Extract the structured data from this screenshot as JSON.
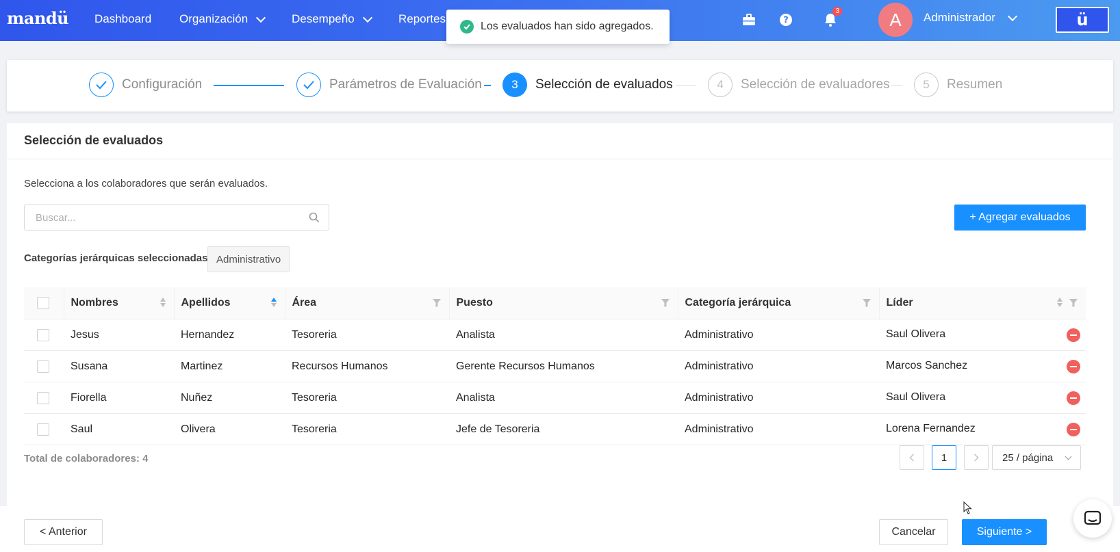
{
  "nav": {
    "logo": "mandü",
    "items": [
      {
        "label": "Dashboard"
      },
      {
        "label": "Organización"
      },
      {
        "label": "Desempeño"
      },
      {
        "label": "Reportes"
      }
    ],
    "notification_count": "3",
    "avatar_letter": "A",
    "username": "Administrador",
    "brand_glyph": "ü"
  },
  "toast": {
    "message": "Los evaluados han sido agregados."
  },
  "steps": [
    {
      "number": "",
      "label": "Configuración",
      "status": "done"
    },
    {
      "number": "",
      "label": "Parámetros de Evaluación",
      "status": "done"
    },
    {
      "number": "3",
      "label": "Selección de evaluados",
      "status": "current"
    },
    {
      "number": "4",
      "label": "Selección de evaluadores",
      "status": "wait"
    },
    {
      "number": "5",
      "label": "Resumen",
      "status": "wait"
    }
  ],
  "card": {
    "title": "Selección de evaluados",
    "subtitle": "Selecciona a los colaboradores que serán evaluados.",
    "search_placeholder": "Buscar...",
    "add_button": "+ Agregar evaluados",
    "categories_label": "Categorías jerárquicas seleccionadas:",
    "category_tag": "Administrativo"
  },
  "table": {
    "headers": {
      "nombres": "Nombres",
      "apellidos": "Apellidos",
      "area": "Área",
      "puesto": "Puesto",
      "categoria": "Categoría jerárquica",
      "lider": "Líder"
    },
    "rows": [
      {
        "nombres": "Jesus",
        "apellidos": "Hernandez",
        "area": "Tesoreria",
        "puesto": "Analista",
        "categoria": "Administrativo",
        "lider": "Saul Olivera"
      },
      {
        "nombres": "Susana",
        "apellidos": "Martinez",
        "area": "Recursos Humanos",
        "puesto": "Gerente Recursos Humanos",
        "categoria": "Administrativo",
        "lider": "Marcos Sanchez"
      },
      {
        "nombres": "Fiorella",
        "apellidos": "Nuñez",
        "area": "Tesoreria",
        "puesto": "Analista",
        "categoria": "Administrativo",
        "lider": "Saul Olivera"
      },
      {
        "nombres": "Saul",
        "apellidos": "Olivera",
        "area": "Tesoreria",
        "puesto": "Jefe de Tesoreria",
        "categoria": "Administrativo",
        "lider": "Lorena Fernandez"
      }
    ]
  },
  "pagination": {
    "total": "Total de colaboradores: 4",
    "current_page": "1",
    "page_size": "25 / página"
  },
  "footer": {
    "previous": "< Anterior",
    "cancel": "Cancelar",
    "next": "Siguiente >"
  },
  "colors": {
    "primary": "#1890ff",
    "nav_gradient_start": "#3056ec",
    "success": "#2fb98a",
    "danger": "#f0605d"
  }
}
